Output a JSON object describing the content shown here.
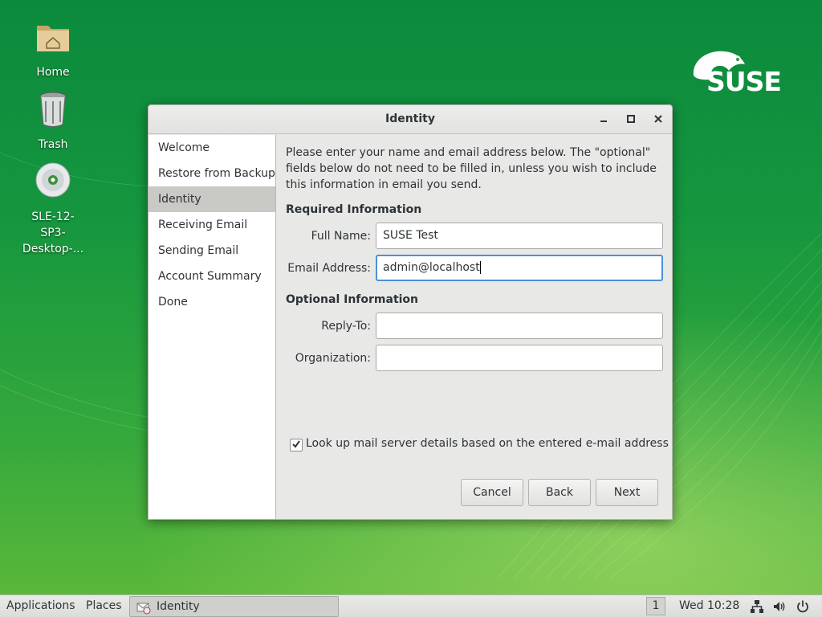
{
  "desktop": {
    "icons": [
      {
        "label": "Home",
        "icon": "home-folder-icon"
      },
      {
        "label": "Trash",
        "icon": "trash-icon"
      },
      {
        "label": "SLE-12-SP3-Desktop-...",
        "icon": "optical-disc-icon"
      }
    ],
    "brand": "SUSE"
  },
  "window": {
    "title": "Identity",
    "controls": [
      "minimize",
      "maximize",
      "close"
    ]
  },
  "sidebar": {
    "items": [
      {
        "label": "Welcome",
        "active": false
      },
      {
        "label": "Restore from Backup",
        "active": false
      },
      {
        "label": "Identity",
        "active": true
      },
      {
        "label": "Receiving Email",
        "active": false
      },
      {
        "label": "Sending Email",
        "active": false
      },
      {
        "label": "Account Summary",
        "active": false
      },
      {
        "label": "Done",
        "active": false
      }
    ]
  },
  "content": {
    "intro": "Please enter your name and email address below. The \"optional\" fields below do not need to be filled in, unless you wish to include this information in email you send.",
    "required_heading": "Required Information",
    "full_name_label": "Full Name:",
    "full_name_value": "SUSE Test",
    "email_label": "Email Address:",
    "email_value": "admin@localhost",
    "optional_heading": "Optional Information",
    "reply_to_label": "Reply-To:",
    "reply_to_value": "",
    "organization_label": "Organization:",
    "organization_value": "",
    "lookup_label": "Look up mail server details based on the entered e-mail address",
    "lookup_checked": true,
    "cancel_label": "Cancel",
    "back_label": "Back",
    "next_label": "Next"
  },
  "taskbar": {
    "applications": "Applications",
    "places": "Places",
    "task_label": "Identity",
    "workspace": "1",
    "clock": "Wed 10:28",
    "tray_icons": [
      "network-icon",
      "volume-icon",
      "power-icon"
    ]
  },
  "colors": {
    "desktop_green": "#1a9a40",
    "focus_blue": "#4a90d9",
    "selected_row": "#c9c9c6"
  }
}
